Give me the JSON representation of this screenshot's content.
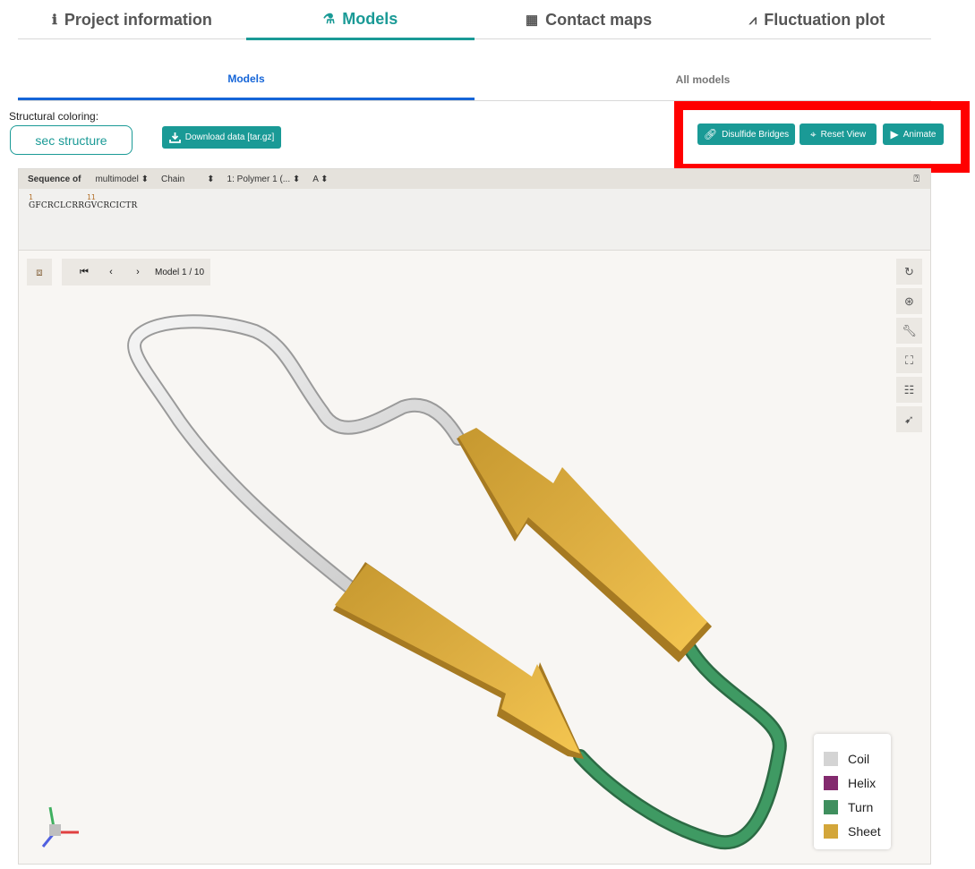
{
  "nav_tabs": [
    {
      "label": "Project information",
      "icon": "info-icon",
      "glyph": "ℹ"
    },
    {
      "label": "Models",
      "icon": "flask-icon",
      "glyph": "⚗"
    },
    {
      "label": "Contact maps",
      "icon": "grid-icon",
      "glyph": "▦"
    },
    {
      "label": "Fluctuation plot",
      "icon": "line-chart-icon",
      "glyph": "⩘"
    }
  ],
  "sub_tabs": [
    "Models",
    "All models"
  ],
  "coloring": {
    "label": "Structural coloring:",
    "button": "sec structure"
  },
  "download_label": "Download data [tar.gz]",
  "actions": [
    {
      "label": "Disulfide Bridges",
      "icon": "link-icon"
    },
    {
      "label": "Reset View",
      "icon": "crosshair-icon"
    },
    {
      "label": "Animate",
      "icon": "play-icon"
    }
  ],
  "sequence": {
    "label": "Sequence of",
    "selects": [
      "multimodel",
      "Chain",
      "1: Polymer 1 (...",
      "A"
    ],
    "positions": [
      "1",
      "11"
    ],
    "residues": "GFCRCLCRRGVCRCICTR",
    "help_icon": "help-icon"
  },
  "viewer": {
    "model_label": "Model 1 / 10",
    "nav_icons": [
      "first-icon",
      "prev-icon",
      "next-icon"
    ],
    "tools": [
      "refresh-icon",
      "spin-icon",
      "wrench-icon",
      "expand-icon",
      "settings-icon",
      "cursor-icon"
    ]
  },
  "legend": [
    {
      "label": "Coil",
      "color": "#d4d4d4"
    },
    {
      "label": "Helix",
      "color": "#832a6e"
    },
    {
      "label": "Turn",
      "color": "#3f8f5e"
    },
    {
      "label": "Sheet",
      "color": "#d3a63a"
    }
  ],
  "colors": {
    "teal": "#1a9a96",
    "blue": "#1565d8",
    "highlight": "#ff0000"
  }
}
